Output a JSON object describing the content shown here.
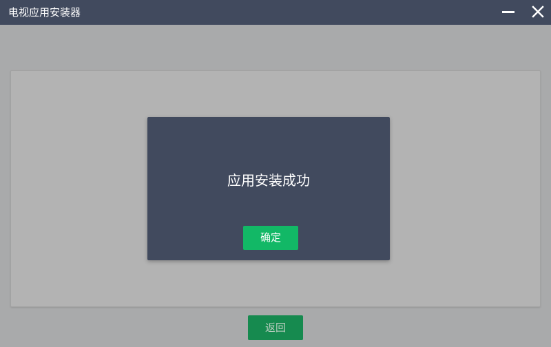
{
  "window": {
    "title": "电视应用安装器",
    "minimize_icon": "minimize-icon",
    "close_icon": "close-icon",
    "colors": {
      "titlebar": "#414a5e",
      "overlay_background": "#a9aaab"
    }
  },
  "main": {
    "back_label": "返回",
    "back_color": "#168a4f"
  },
  "dialog": {
    "message": "应用安装成功",
    "confirm_label": "确定",
    "colors": {
      "background": "#414a5e",
      "confirm": "#12b866"
    }
  }
}
